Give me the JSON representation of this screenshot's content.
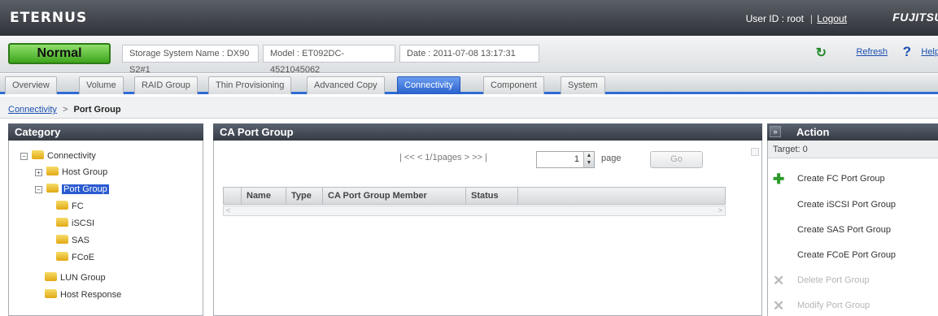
{
  "header": {
    "logo": "ETERNUS",
    "user_label": "User ID : root",
    "separator": "|",
    "logout": "Logout",
    "brand": "FUJITSU"
  },
  "status": {
    "state": "Normal",
    "storage_name": "Storage System Name : DX90 S2#1",
    "model": "Model : ET092DC-4521045062",
    "date": "Date : 2011-07-08 13:17:31",
    "refresh": "Refresh",
    "help": "Help",
    "colors": {
      "normal": "#3fa41d",
      "accent": "#2f6bd6"
    }
  },
  "tabs": [
    {
      "label": "Overview"
    },
    {
      "label": "Volume"
    },
    {
      "label": "RAID Group"
    },
    {
      "label": "Thin Provisioning"
    },
    {
      "label": "Advanced Copy"
    },
    {
      "label": "Connectivity"
    },
    {
      "label": "Component"
    },
    {
      "label": "System"
    }
  ],
  "active_tab": "Connectivity",
  "breadcrumb": {
    "link": "Connectivity",
    "separator": ">",
    "current": "Port Group"
  },
  "category": {
    "title": "Category",
    "tree": [
      {
        "label": "Connectivity",
        "expander": "−"
      },
      {
        "label": "Host Group",
        "expander": "+"
      },
      {
        "label": "Port Group",
        "expander": "−"
      },
      {
        "label": "FC"
      },
      {
        "label": "iSCSI"
      },
      {
        "label": "SAS"
      },
      {
        "label": "FCoE"
      },
      {
        "label": "LUN Group"
      },
      {
        "label": "Host Response"
      }
    ]
  },
  "main": {
    "title": "CA Port Group",
    "pager_text": "| << < 1/1pages > >> |",
    "page_value": "1",
    "page_label": "page",
    "go": "Go",
    "columns": [
      "Name",
      "Type",
      "CA Port Group Member",
      "Status"
    ]
  },
  "action": {
    "title": "Action",
    "target": "Target: 0",
    "items": [
      {
        "label": "Create FC Port Group",
        "icon": "plus-icon"
      },
      {
        "label": "Create iSCSI Port Group"
      },
      {
        "label": "Create SAS Port Group"
      },
      {
        "label": "Create FCoE Port Group"
      },
      {
        "label": "Delete Port Group",
        "icon": "x-icon"
      },
      {
        "label": "Modify Port Group",
        "icon": "x-icon"
      }
    ]
  }
}
